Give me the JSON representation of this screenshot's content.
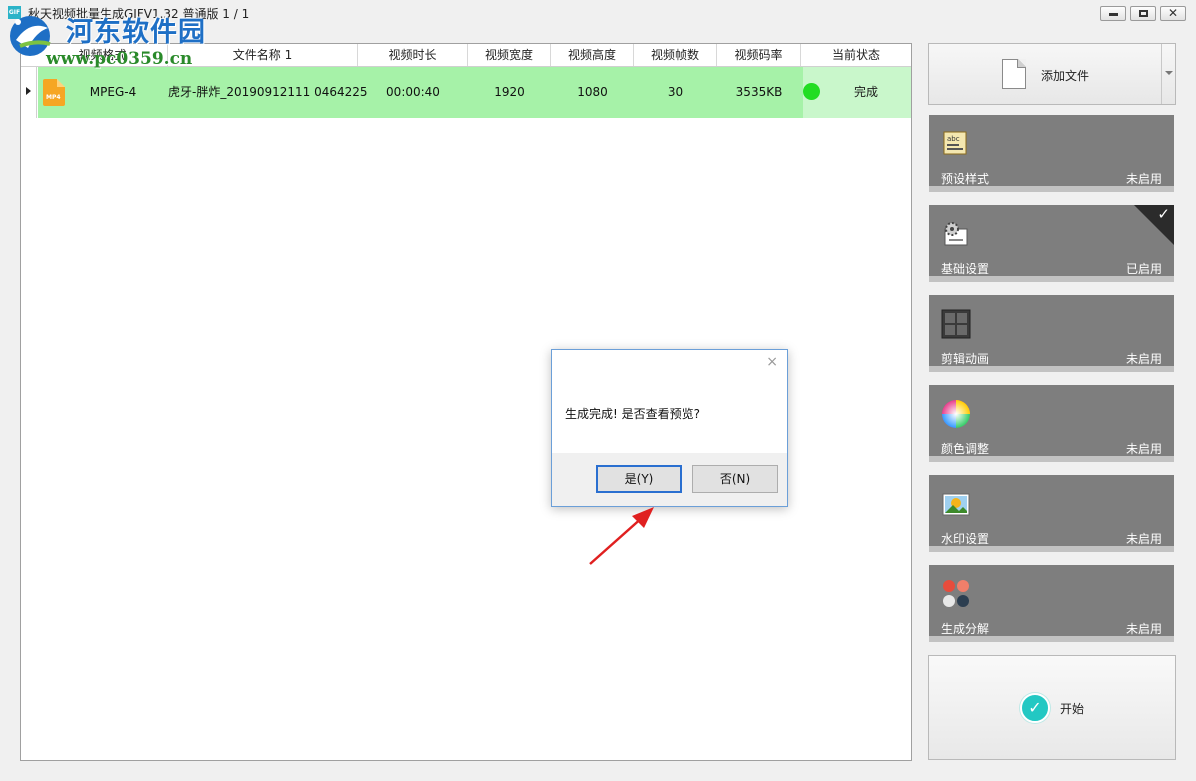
{
  "window": {
    "app_icon_text": "GIF",
    "title": "秋天视频批量生成GIFV1.32 普通版  1 / 1"
  },
  "watermark": {
    "name": "河东软件园",
    "url": "www.pc0359.cn"
  },
  "table": {
    "headers": [
      "视频格式",
      "文件名称 1",
      "视频时长",
      "视频宽度",
      "视频高度",
      "视频帧数",
      "视频码率",
      "当前状态"
    ],
    "rows": [
      {
        "icon": "mp4-file-icon",
        "icon_text": "MP4",
        "format": "MPEG-4",
        "filename": "虎牙-胖炸_20190912111 0464225",
        "duration": "00:00:40",
        "width": "1920",
        "height": "1080",
        "frames": "30",
        "bitrate": "3535KB",
        "status": "完成",
        "status_color": "#22dd22"
      }
    ]
  },
  "sidebar": {
    "add_file": "添加文件",
    "features": [
      {
        "label": "预设样式",
        "state": "未启用",
        "icon": "preset-style-icon"
      },
      {
        "label": "基础设置",
        "state": "已启用",
        "icon": "basic-settings-icon"
      },
      {
        "label": "剪辑动画",
        "state": "未启用",
        "icon": "clip-animation-icon"
      },
      {
        "label": "颜色调整",
        "state": "未启用",
        "icon": "color-adjust-icon"
      },
      {
        "label": "水印设置",
        "state": "未启用",
        "icon": "watermark-settings-icon"
      },
      {
        "label": "生成分解",
        "state": "未启用",
        "icon": "generate-decompose-icon"
      }
    ],
    "start": "开始"
  },
  "dialog": {
    "message": "生成完成! 是否查看预览?",
    "yes": "是(Y)",
    "no": "否(N)",
    "close": "×"
  },
  "colors": {
    "row_highlight": "#a6f2a8",
    "feature_bg": "#7e7e7e",
    "start_icon": "#22c8c3",
    "dialog_border": "#6b9fd8"
  }
}
